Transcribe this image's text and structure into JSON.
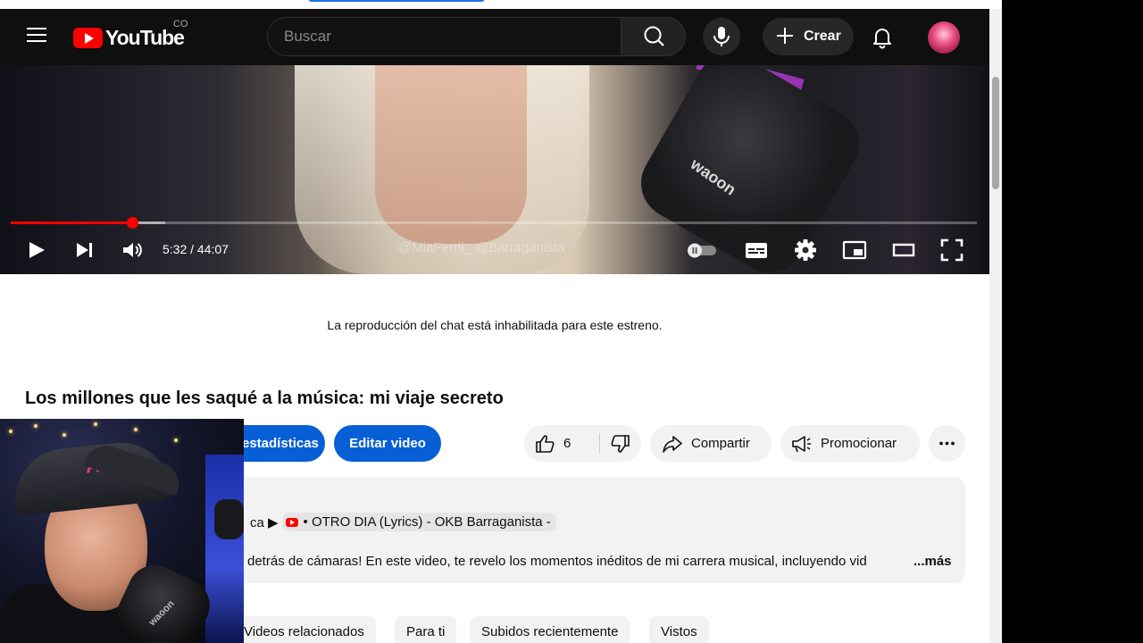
{
  "masthead": {
    "logo_text": "YouTube",
    "country_code": "CO",
    "search_placeholder": "Buscar",
    "create_label": "Crear"
  },
  "player": {
    "time_display": "5:32 / 44:07",
    "watermark": "@MiaFerrli_ @Barraganista",
    "mic_brand_text": "waoon",
    "progress_fraction": 0.1257,
    "buffer_fraction": 0.16
  },
  "chat_notice": "La reproducción del chat está inhabilitada para este estreno.",
  "video": {
    "title": "Los millones que les saqué a la música: mi viaje secreto"
  },
  "actions": {
    "stats_label": "estadísticas",
    "edit_label": "Editar video",
    "like_count": "6",
    "share_label": "Compartir",
    "promote_label": "Promocionar"
  },
  "description": {
    "line1_prefix": "ca ▶",
    "chip_text": "• OTRO DIA  (Lyrics) - OKB Barraganista -",
    "line2": "detrás de cámaras! En este video, te revelo los momentos inéditos de mi carrera musical, incluyendo vid",
    "more_label": "...más"
  },
  "chips": [
    {
      "label": "Videos relacionados"
    },
    {
      "label": "Para ti"
    },
    {
      "label": "Subidos recientemente"
    },
    {
      "label": "Vistos"
    }
  ],
  "webcam": {
    "cap_logo": "A",
    "mic_text": "waoon"
  },
  "colors": {
    "masthead_bg": "#0f0f0f",
    "brand_red": "#ff0000",
    "action_blue": "#065fd4",
    "pill_grey": "#f2f2f2"
  }
}
